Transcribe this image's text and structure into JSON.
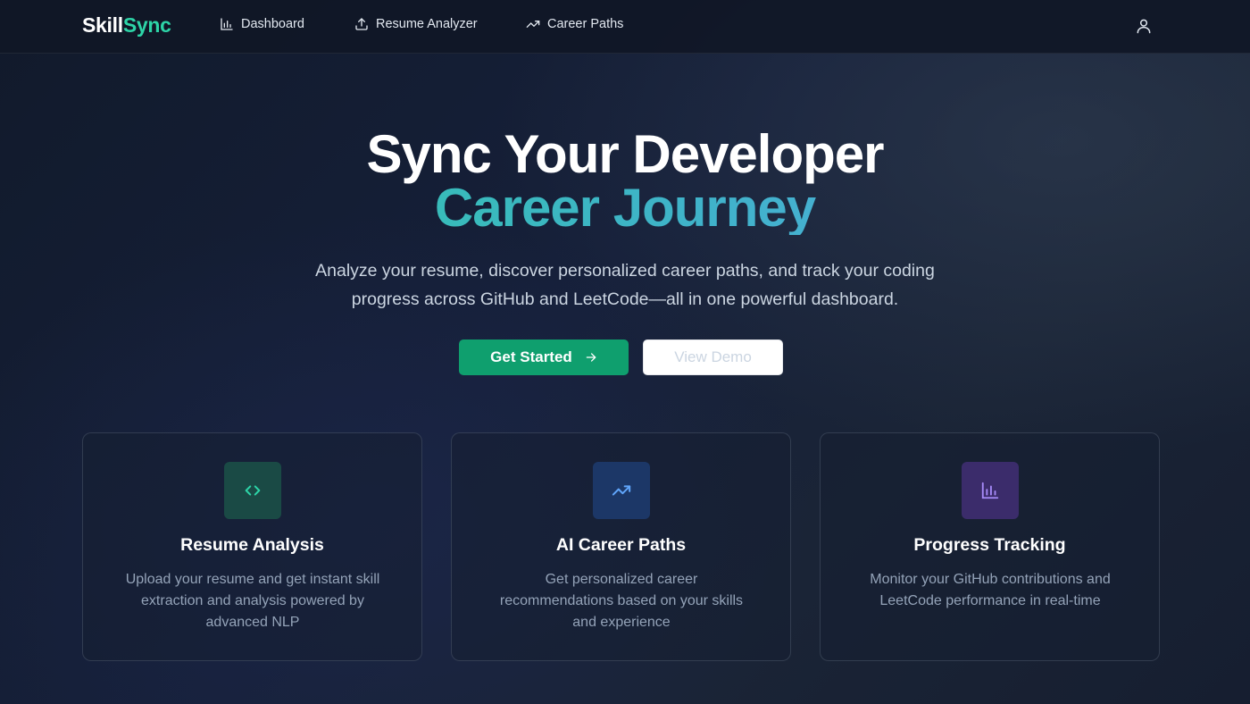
{
  "nav": {
    "brand_part1": "Skill",
    "brand_part2": "Sync",
    "links": [
      {
        "label": "Dashboard",
        "icon": "bar-chart-icon"
      },
      {
        "label": "Resume Analyzer",
        "icon": "upload-icon"
      },
      {
        "label": "Career Paths",
        "icon": "trending-up-icon"
      }
    ],
    "user_icon": "user-icon"
  },
  "hero": {
    "title_line1": "Sync Your Developer",
    "title_line2": "Career Journey",
    "subtitle": "Analyze your resume, discover personalized career paths, and track your coding progress across GitHub and LeetCode—all in one powerful dashboard.",
    "primary_button": "Get Started",
    "secondary_button": "View Demo"
  },
  "features": [
    {
      "title": "Resume Analysis",
      "description": "Upload your resume and get instant skill extraction and analysis powered by advanced NLP",
      "icon": "code-icon",
      "accent": "#2dd4a7"
    },
    {
      "title": "AI Career Paths",
      "description": "Get personalized career recommendations based on your skills and experience",
      "icon": "trending-up-icon",
      "accent": "#60a5fa"
    },
    {
      "title": "Progress Tracking",
      "description": "Monitor your GitHub contributions and LeetCode performance in real-time",
      "icon": "bar-chart-icon",
      "accent": "#a78bfa"
    }
  ],
  "colors": {
    "brand_accent": "#2dd4a7",
    "primary_button": "#0f9f6e",
    "background": "#131c2e"
  }
}
